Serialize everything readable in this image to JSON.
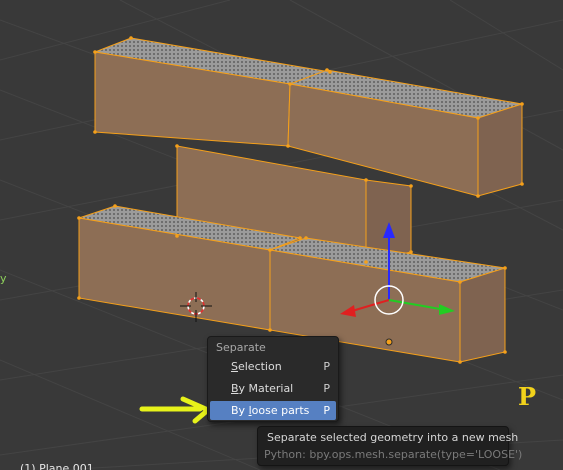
{
  "separate_menu": {
    "title": "Separate",
    "items": [
      {
        "mnemonic": "S",
        "rest": "election",
        "shortcut": "P"
      },
      {
        "mnemonic": "B",
        "rest": "y Material",
        "shortcut": "P"
      },
      {
        "pre": "By ",
        "mnemonic": "l",
        "rest": "oose parts",
        "shortcut": "P",
        "highlighted": true
      }
    ]
  },
  "tooltip": {
    "description": "Separate selected geometry into a new mesh",
    "python": "Python: bpy.ops.mesh.separate(type='LOOSE')"
  },
  "key_indicator": "P",
  "object_info": "(1) Plane.001",
  "axis_label": "y",
  "colors": {
    "viewport_bg": "#393939",
    "grid": "#444444",
    "brick_front": "#8d6e55",
    "brick_side": "#7f6350",
    "selection_edge": "#f5a01a",
    "menu_highlight": "#5680c2",
    "annotation_arrow": "#e7f21a",
    "key_indicator": "#f2d21b"
  }
}
